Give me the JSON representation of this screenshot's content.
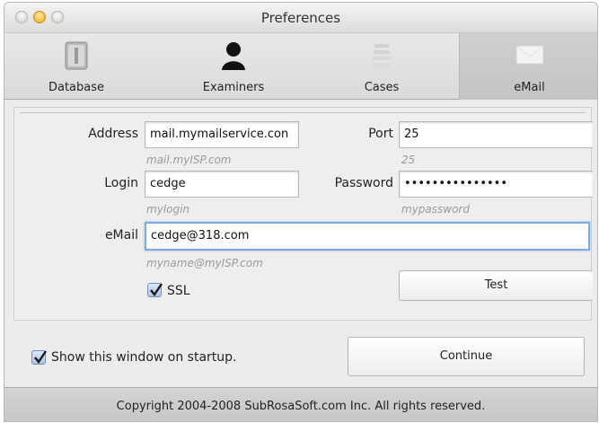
{
  "window": {
    "title": "Preferences"
  },
  "toolbar": {
    "items": [
      {
        "label": "Database",
        "icon": "database-icon"
      },
      {
        "label": "Examiners",
        "icon": "person-icon"
      },
      {
        "label": "Cases",
        "icon": "cases-icon"
      },
      {
        "label": "eMail",
        "icon": "email-icon",
        "selected": true
      }
    ]
  },
  "form": {
    "address": {
      "label": "Address",
      "value": "mail.mymailservice.con",
      "hint": "mail.myISP.com"
    },
    "port": {
      "label": "Port",
      "value": "25",
      "hint": "25"
    },
    "login": {
      "label": "Login",
      "value": "cedge",
      "hint": "mylogin"
    },
    "password": {
      "label": "Password",
      "value": "•••••••••••••••",
      "hint": "mypassword"
    },
    "email": {
      "label": "eMail",
      "value": "cedge@318.com",
      "hint": "myname@myISP.com"
    },
    "ssl": {
      "label": "SSL",
      "checked": true
    },
    "test_label": "Test"
  },
  "startup": {
    "label": "Show this window on startup.",
    "checked": true
  },
  "continue_label": "Continue",
  "footer": {
    "copyright": "Copyright 2004-2008 SubRosaSoft.com Inc. All rights reserved."
  },
  "colors": {
    "focus_ring": "#7fa9e0",
    "checkbox": "#a9c4e8",
    "window_bg": "#ececec"
  }
}
